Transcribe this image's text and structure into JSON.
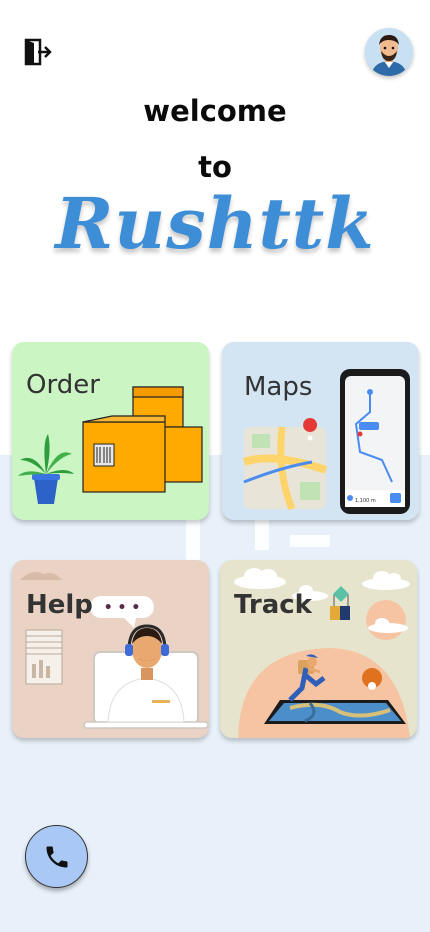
{
  "header": {
    "logout_icon": "logout-icon",
    "avatar_icon": "user-avatar"
  },
  "hero": {
    "line1": "welcome",
    "line2": "to",
    "brand": "Rushttk",
    "brand_color": "#3d8ed6"
  },
  "cards": {
    "order": {
      "label": "Order",
      "color": "#ccf5c4"
    },
    "maps": {
      "label": "Maps",
      "color": "#d3e4f3",
      "distance": "1,100 m",
      "pin": "Marker"
    },
    "help": {
      "label": "Help",
      "color": "#ead3c4",
      "bubble": "• • •"
    },
    "track": {
      "label": "Track",
      "color": "#e6e4cd"
    }
  },
  "call_button": {
    "icon": "phone-icon",
    "color": "#a9c8f5"
  }
}
